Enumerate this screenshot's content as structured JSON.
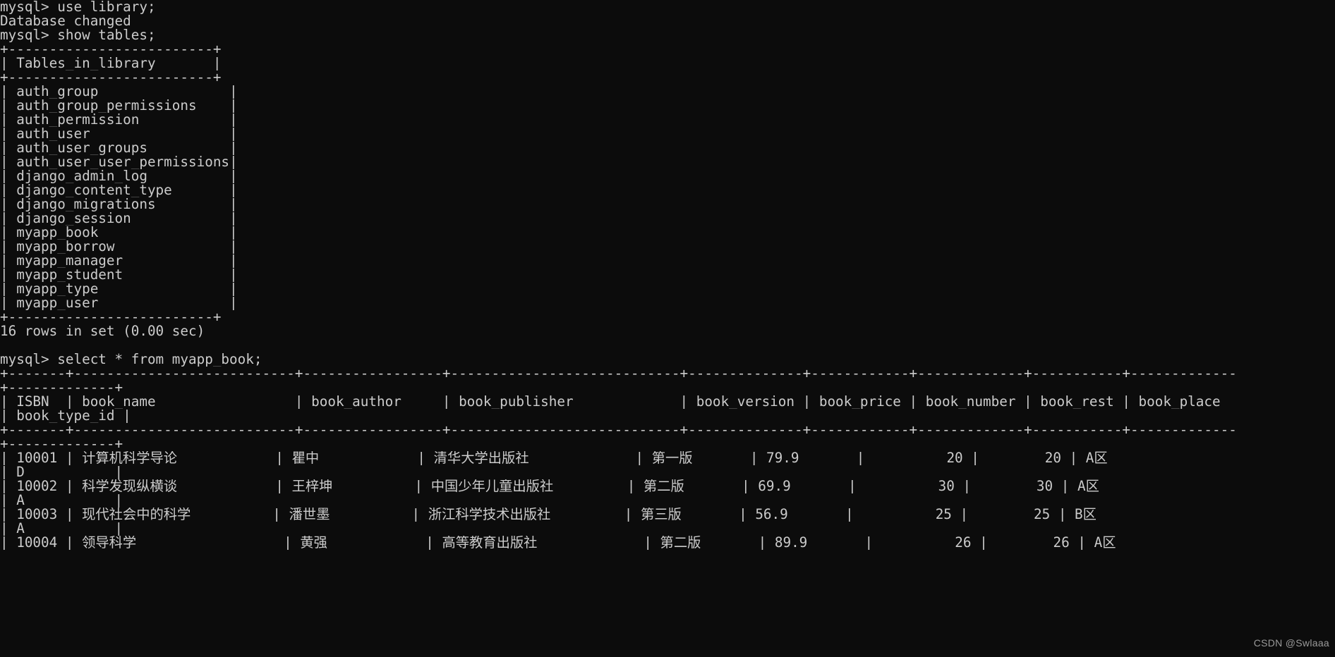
{
  "terminal": {
    "prompt": "mysql>",
    "background_color": "#0c0c0c",
    "text_color": "#cccccc",
    "font_size_px": 19.3
  },
  "watermark": {
    "text": "CSDN @Swlaaa"
  },
  "session": {
    "commands": [
      {
        "id": "cmd_use",
        "text": "mysql> use library;"
      },
      {
        "id": "cmd_show",
        "text": "mysql> show tables;"
      },
      {
        "id": "cmd_select",
        "text": "mysql> select * from myapp_book;"
      }
    ],
    "messages": [
      {
        "id": "msg_db_changed",
        "text": "Database changed"
      },
      {
        "id": "msg_rows_in_set",
        "text": "16 rows in set (0.00 sec)"
      }
    ]
  },
  "show_tables_result": {
    "header": "Tables_in_library",
    "border": "+-------------------------+",
    "row_count": 16,
    "tables": [
      "auth_group",
      "auth_group_permissions",
      "auth_permission",
      "auth_user",
      "auth_user_groups",
      "auth_user_user_permissions",
      "django_admin_log",
      "django_content_type",
      "django_migrations",
      "django_session",
      "myapp_book",
      "myapp_borrow",
      "myapp_manager",
      "myapp_student",
      "myapp_type",
      "myapp_user"
    ]
  },
  "book_table": {
    "columns": [
      "ISBN",
      "book_name",
      "book_author",
      "book_publisher",
      "book_version",
      "book_price",
      "book_number",
      "book_rest",
      "book_place",
      "book_type_id"
    ],
    "rows": [
      {
        "ISBN": "10001",
        "book_name": "计算机科学导论",
        "book_author": "瞿中",
        "book_publisher": "清华大学出版社",
        "book_version": "第一版",
        "book_price": "79.9",
        "book_number": "20",
        "book_rest": "20",
        "book_place": "A区",
        "book_type_id": "D"
      },
      {
        "ISBN": "10002",
        "book_name": "科学发现纵横谈",
        "book_author": "王梓坤",
        "book_publisher": "中国少年儿童出版社",
        "book_version": "第二版",
        "book_price": "69.9",
        "book_number": "30",
        "book_rest": "30",
        "book_place": "A区",
        "book_type_id": "A"
      },
      {
        "ISBN": "10003",
        "book_name": "现代社会中的科学",
        "book_author": "潘世墨",
        "book_publisher": "浙江科学技术出版社",
        "book_version": "第三版",
        "book_price": "56.9",
        "book_number": "25",
        "book_rest": "25",
        "book_place": "B区",
        "book_type_id": "A"
      },
      {
        "ISBN": "10004",
        "book_name": "领导科学",
        "book_author": "黄强",
        "book_publisher": "高等教育出版社",
        "book_version": "第二版",
        "book_price": "89.9",
        "book_number": "26",
        "book_rest": "26",
        "book_place": "A区",
        "book_type_id": ""
      }
    ]
  },
  "rendered_lines": [
    {
      "name": "line-cmd-use",
      "text": "mysql> use library;"
    },
    {
      "name": "line-database-changed",
      "text": "Database changed"
    },
    {
      "name": "line-cmd-show-tables",
      "text": "mysql> show tables;"
    },
    {
      "name": "line-border-top",
      "text": "+-------------------------+"
    },
    {
      "name": "line-header-tables",
      "text": "| Tables_in_library       |"
    },
    {
      "name": "line-border-header",
      "text": "+-------------------------+"
    },
    {
      "name": "line-table-auth-group",
      "text": "| auth_group                |"
    },
    {
      "name": "line-table-auth-group-permissions",
      "text": "| auth_group_permissions    |"
    },
    {
      "name": "line-table-auth-permission",
      "text": "| auth_permission           |"
    },
    {
      "name": "line-table-auth-user",
      "text": "| auth_user                 |"
    },
    {
      "name": "line-table-auth-user-groups",
      "text": "| auth_user_groups          |"
    },
    {
      "name": "line-table-auth-user-user-permissions",
      "text": "| auth_user_user_permissions|"
    },
    {
      "name": "line-table-django-admin-log",
      "text": "| django_admin_log          |"
    },
    {
      "name": "line-table-django-content-type",
      "text": "| django_content_type       |"
    },
    {
      "name": "line-table-django-migrations",
      "text": "| django_migrations         |"
    },
    {
      "name": "line-table-django-session",
      "text": "| django_session            |"
    },
    {
      "name": "line-table-myapp-book",
      "text": "| myapp_book                |"
    },
    {
      "name": "line-table-myapp-borrow",
      "text": "| myapp_borrow              |"
    },
    {
      "name": "line-table-myapp-manager",
      "text": "| myapp_manager             |"
    },
    {
      "name": "line-table-myapp-student",
      "text": "| myapp_student             |"
    },
    {
      "name": "line-table-myapp-type",
      "text": "| myapp_type                |"
    },
    {
      "name": "line-table-myapp-user",
      "text": "| myapp_user                |"
    },
    {
      "name": "line-border-bottom",
      "text": "+-------------------------+"
    },
    {
      "name": "line-rows-in-set",
      "text": "16 rows in set (0.00 sec)"
    },
    {
      "name": "line-blank-1",
      "text": " "
    },
    {
      "name": "line-cmd-select",
      "text": "mysql> select * from myapp_book;"
    },
    {
      "name": "line-book-border-top-a",
      "text": "+-------+---------------------------+-----------------+----------------------------+--------------+------------+-------------+-----------+-------------"
    },
    {
      "name": "line-book-border-top-b",
      "text": "+-------------+"
    },
    {
      "name": "line-book-header-a",
      "text": "| ISBN  | book_name                 | book_author     | book_publisher             | book_version | book_price | book_number | book_rest | book_place "
    },
    {
      "name": "line-book-header-b",
      "text": "| book_type_id |"
    },
    {
      "name": "line-book-border-mid-a",
      "text": "+-------+---------------------------+-----------------+----------------------------+--------------+------------+-------------+-----------+-------------"
    },
    {
      "name": "line-book-border-mid-b",
      "text": "+-------------+"
    },
    {
      "name": "line-book-row-1-a",
      "text": "| 10001 | 计算机科学导论            | 瞿中            | 清华大学出版社             | 第一版       | 79.9       |          20 |        20 | A区"
    },
    {
      "name": "line-book-row-1-b",
      "text": "| D           |"
    },
    {
      "name": "line-book-row-2-a",
      "text": "| 10002 | 科学发现纵横谈            | 王梓坤          | 中国少年儿童出版社         | 第二版       | 69.9       |          30 |        30 | A区"
    },
    {
      "name": "line-book-row-2-b",
      "text": "| A           |"
    },
    {
      "name": "line-book-row-3-a",
      "text": "| 10003 | 现代社会中的科学          | 潘世墨          | 浙江科学技术出版社         | 第三版       | 56.9       |          25 |        25 | B区"
    },
    {
      "name": "line-book-row-3-b",
      "text": "| A           |"
    },
    {
      "name": "line-book-row-4-a",
      "text": "| 10004 | 领导科学                  | 黄强            | 高等教育出版社             | 第二版       | 89.9       |          26 |        26 | A区"
    }
  ]
}
